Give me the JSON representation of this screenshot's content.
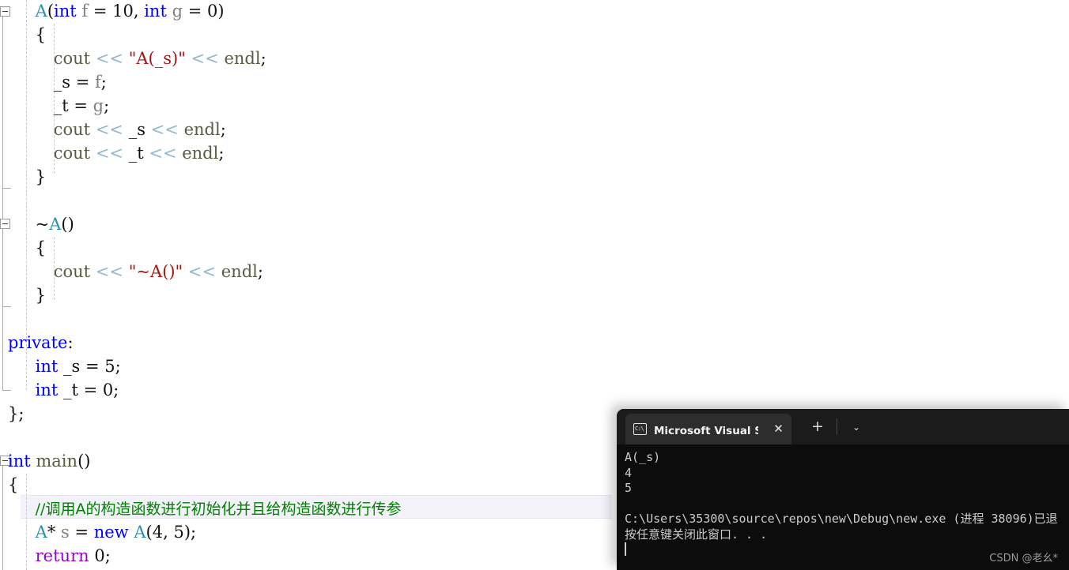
{
  "editor": {
    "language": "C++",
    "background": "#ffffff",
    "current_line_highlight": "#f3f2f9",
    "colors": {
      "keyword": "#0000ff",
      "type": "#2b91af",
      "identifier": "#808080",
      "string": "#a31515",
      "stream_operator": "#8fb9d0",
      "return_keyword": "#8f08c4",
      "comment": "#008000",
      "plain": "#111111"
    },
    "lines": [
      {
        "indent": 3,
        "tokens": [
          {
            "t": "A",
            "c": "type"
          },
          {
            "t": "(",
            "c": "plain"
          },
          {
            "t": "int",
            "c": "kw"
          },
          {
            "t": " ",
            "c": "plain"
          },
          {
            "t": "f",
            "c": "id"
          },
          {
            "t": " = ",
            "c": "plain"
          },
          {
            "t": "10",
            "c": "plain"
          },
          {
            "t": ", ",
            "c": "plain"
          },
          {
            "t": "int",
            "c": "kw"
          },
          {
            "t": " ",
            "c": "plain"
          },
          {
            "t": "g",
            "c": "id"
          },
          {
            "t": " = ",
            "c": "plain"
          },
          {
            "t": "0",
            "c": "plain"
          },
          {
            "t": ")",
            "c": "plain"
          }
        ]
      },
      {
        "indent": 3,
        "tokens": [
          {
            "t": "{",
            "c": "plain"
          }
        ]
      },
      {
        "indent": 5,
        "tokens": [
          {
            "t": "cout",
            "c": "fn"
          },
          {
            "t": " ",
            "c": "plain"
          },
          {
            "t": "<<",
            "c": "op"
          },
          {
            "t": " ",
            "c": "plain"
          },
          {
            "t": "\"A(_s)\"",
            "c": "str"
          },
          {
            "t": " ",
            "c": "plain"
          },
          {
            "t": "<<",
            "c": "op"
          },
          {
            "t": " ",
            "c": "plain"
          },
          {
            "t": "endl",
            "c": "fn"
          },
          {
            "t": ";",
            "c": "plain"
          }
        ]
      },
      {
        "indent": 5,
        "tokens": [
          {
            "t": "_s",
            "c": "plain"
          },
          {
            "t": " = ",
            "c": "plain"
          },
          {
            "t": "f",
            "c": "id"
          },
          {
            "t": ";",
            "c": "plain"
          }
        ]
      },
      {
        "indent": 5,
        "tokens": [
          {
            "t": "_t",
            "c": "plain"
          },
          {
            "t": " = ",
            "c": "plain"
          },
          {
            "t": "g",
            "c": "id"
          },
          {
            "t": ";",
            "c": "plain"
          }
        ]
      },
      {
        "indent": 5,
        "tokens": [
          {
            "t": "cout",
            "c": "fn"
          },
          {
            "t": " ",
            "c": "plain"
          },
          {
            "t": "<<",
            "c": "op"
          },
          {
            "t": " ",
            "c": "plain"
          },
          {
            "t": "_s",
            "c": "plain"
          },
          {
            "t": " ",
            "c": "plain"
          },
          {
            "t": "<<",
            "c": "op"
          },
          {
            "t": " ",
            "c": "plain"
          },
          {
            "t": "endl",
            "c": "fn"
          },
          {
            "t": ";",
            "c": "plain"
          }
        ]
      },
      {
        "indent": 5,
        "tokens": [
          {
            "t": "cout",
            "c": "fn"
          },
          {
            "t": " ",
            "c": "plain"
          },
          {
            "t": "<<",
            "c": "op"
          },
          {
            "t": " ",
            "c": "plain"
          },
          {
            "t": "_t",
            "c": "plain"
          },
          {
            "t": " ",
            "c": "plain"
          },
          {
            "t": "<<",
            "c": "op"
          },
          {
            "t": " ",
            "c": "plain"
          },
          {
            "t": "endl",
            "c": "fn"
          },
          {
            "t": ";",
            "c": "plain"
          }
        ]
      },
      {
        "indent": 3,
        "tokens": [
          {
            "t": "}",
            "c": "plain"
          }
        ]
      },
      {
        "indent": 0,
        "tokens": []
      },
      {
        "indent": 3,
        "tokens": [
          {
            "t": "~",
            "c": "plain"
          },
          {
            "t": "A",
            "c": "type"
          },
          {
            "t": "()",
            "c": "plain"
          }
        ]
      },
      {
        "indent": 3,
        "tokens": [
          {
            "t": "{",
            "c": "plain"
          }
        ]
      },
      {
        "indent": 5,
        "tokens": [
          {
            "t": "cout",
            "c": "fn"
          },
          {
            "t": " ",
            "c": "plain"
          },
          {
            "t": "<<",
            "c": "op"
          },
          {
            "t": " ",
            "c": "plain"
          },
          {
            "t": "\"~A()\"",
            "c": "str"
          },
          {
            "t": " ",
            "c": "plain"
          },
          {
            "t": "<<",
            "c": "op"
          },
          {
            "t": " ",
            "c": "plain"
          },
          {
            "t": "endl",
            "c": "fn"
          },
          {
            "t": ";",
            "c": "plain"
          }
        ]
      },
      {
        "indent": 3,
        "tokens": [
          {
            "t": "}",
            "c": "plain"
          }
        ]
      },
      {
        "indent": 0,
        "tokens": []
      },
      {
        "indent": 0,
        "tokens": [
          {
            "t": "private",
            "c": "kw"
          },
          {
            "t": ":",
            "c": "plain"
          }
        ]
      },
      {
        "indent": 3,
        "tokens": [
          {
            "t": "int",
            "c": "kw"
          },
          {
            "t": " ",
            "c": "plain"
          },
          {
            "t": "_s",
            "c": "plain"
          },
          {
            "t": " = ",
            "c": "plain"
          },
          {
            "t": "5",
            "c": "plain"
          },
          {
            "t": ";",
            "c": "plain"
          }
        ]
      },
      {
        "indent": 3,
        "tokens": [
          {
            "t": "int",
            "c": "kw"
          },
          {
            "t": " ",
            "c": "plain"
          },
          {
            "t": "_t",
            "c": "plain"
          },
          {
            "t": " = ",
            "c": "plain"
          },
          {
            "t": "0",
            "c": "plain"
          },
          {
            "t": ";",
            "c": "plain"
          }
        ]
      },
      {
        "indent": 0,
        "tokens": [
          {
            "t": "};",
            "c": "plain"
          }
        ]
      },
      {
        "indent": 0,
        "tokens": []
      },
      {
        "indent": 0,
        "tokens": [
          {
            "t": "int",
            "c": "kw"
          },
          {
            "t": " ",
            "c": "plain"
          },
          {
            "t": "main",
            "c": "fn"
          },
          {
            "t": "()",
            "c": "plain"
          }
        ]
      },
      {
        "indent": 0,
        "tokens": [
          {
            "t": "{",
            "c": "plain"
          }
        ]
      },
      {
        "indent": 3,
        "highlight": true,
        "tokens": [
          {
            "t": "//调用A的构造函数进行初始化并且给构造函数进行传参",
            "c": "cmt"
          }
        ]
      },
      {
        "indent": 3,
        "tokens": [
          {
            "t": "A",
            "c": "type"
          },
          {
            "t": "* ",
            "c": "plain"
          },
          {
            "t": "s",
            "c": "id"
          },
          {
            "t": " = ",
            "c": "plain"
          },
          {
            "t": "new",
            "c": "kw"
          },
          {
            "t": " ",
            "c": "plain"
          },
          {
            "t": "A",
            "c": "type"
          },
          {
            "t": "(",
            "c": "plain"
          },
          {
            "t": "4",
            "c": "plain"
          },
          {
            "t": ", ",
            "c": "plain"
          },
          {
            "t": "5",
            "c": "plain"
          },
          {
            "t": ");",
            "c": "plain"
          }
        ]
      },
      {
        "indent": 3,
        "tokens": [
          {
            "t": "return",
            "c": "ret"
          },
          {
            "t": " ",
            "c": "plain"
          },
          {
            "t": "0",
            "c": "plain"
          },
          {
            "t": ";",
            "c": "plain"
          }
        ]
      }
    ]
  },
  "terminal": {
    "tab": {
      "icon": "console-icon",
      "icon_text": "C:\\",
      "title": "Microsoft Visual Studio 调试控",
      "close_label": "✕"
    },
    "new_tab_label": "+",
    "dropdown_label": "⌄",
    "output_lines": [
      "A(_s)",
      "4",
      "5",
      "",
      "C:\\Users\\35300\\source\\repos\\new\\Debug\\new.exe (进程 38096)已退",
      "按任意键关闭此窗口. . ."
    ],
    "watermark": "CSDN @老幺*",
    "background": "#0c0c0c",
    "foreground": "#cccccc"
  }
}
